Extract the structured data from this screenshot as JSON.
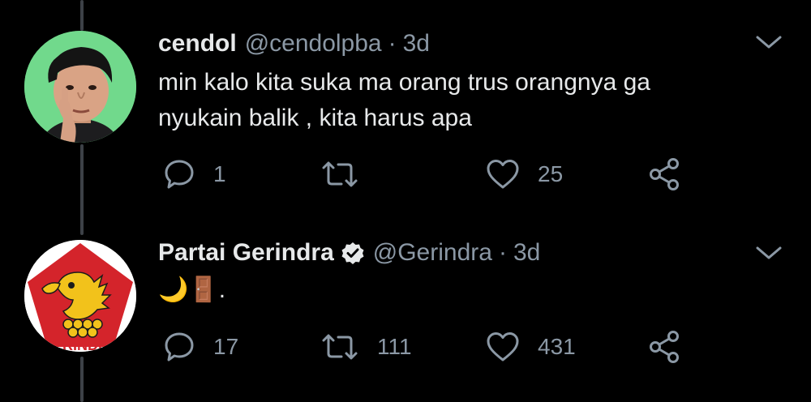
{
  "tweets": [
    {
      "name": "cendol",
      "handle": "@cendolpba",
      "separator": "·",
      "time": "3d",
      "text_lines": [
        "min kalo kita suka ma orang trus orangnya ga",
        "nyukain balik , kita harus apa"
      ],
      "verified": false,
      "avatar_icon": "person-photo-avatar",
      "counts": {
        "reply": "1",
        "retweet": "",
        "like": "25"
      }
    },
    {
      "name": "Partai Gerindra",
      "handle": "@Gerindra",
      "separator": "·",
      "time": "3d",
      "text": "🌙🚪.",
      "verified": true,
      "avatar_icon": "gerindra-logo",
      "avatar_logo_text": "GERINDRA",
      "counts": {
        "reply": "17",
        "retweet": "111",
        "like": "431"
      }
    }
  ],
  "icons": {
    "reply": "reply-icon",
    "retweet": "retweet-icon",
    "like": "like-icon",
    "share": "share-icon",
    "caret": "chevron-down-icon",
    "verified": "verified-badge-icon"
  },
  "colors": {
    "background": "#000000",
    "text": "#e7e9ea",
    "muted": "#8b98a5",
    "thread_line": "#3d4147",
    "gerindra_red": "#d4242b",
    "gerindra_gold": "#f2c21b"
  }
}
